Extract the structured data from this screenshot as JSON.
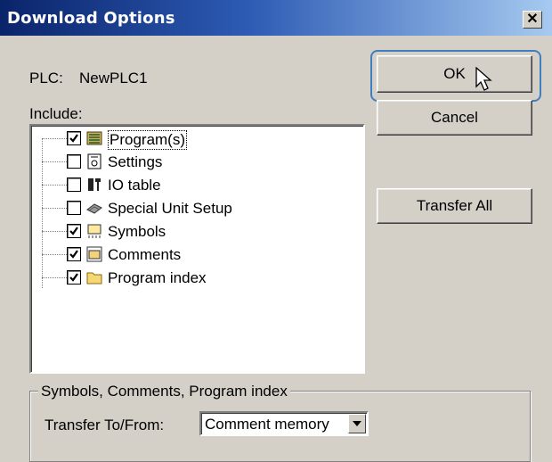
{
  "window": {
    "title": "Download Options",
    "close_glyph": "✕"
  },
  "plc": {
    "label": "PLC:",
    "name": "NewPLC1"
  },
  "include": {
    "label": "Include:"
  },
  "tree": {
    "items": [
      {
        "label": "Program(s)",
        "checked": true,
        "icon": "program-icon",
        "selected": true
      },
      {
        "label": "Settings",
        "checked": false,
        "icon": "settings-icon",
        "selected": false
      },
      {
        "label": "IO table",
        "checked": false,
        "icon": "io-table-icon",
        "selected": false
      },
      {
        "label": "Special Unit Setup",
        "checked": false,
        "icon": "special-unit-icon",
        "selected": false
      },
      {
        "label": "Symbols",
        "checked": true,
        "icon": "symbols-icon",
        "selected": false
      },
      {
        "label": "Comments",
        "checked": true,
        "icon": "comments-icon",
        "selected": false
      },
      {
        "label": "Program index",
        "checked": true,
        "icon": "folder-icon",
        "selected": false
      }
    ]
  },
  "buttons": {
    "ok": "OK",
    "cancel": "Cancel",
    "transfer_all": "Transfer All"
  },
  "group": {
    "legend": "Symbols, Comments, Program index",
    "transfer_label": "Transfer To/From:",
    "transfer_value": "Comment memory"
  },
  "colors": {
    "title_start": "#0a246a",
    "title_end": "#a6caf0",
    "focus_ring": "#3f7fc0",
    "face": "#d4d0c8"
  }
}
